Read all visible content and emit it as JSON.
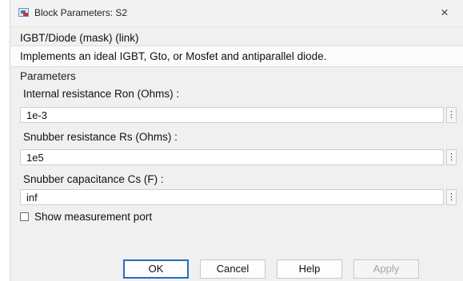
{
  "window": {
    "title": "Block Parameters: S2",
    "close_glyph": "×"
  },
  "mask": {
    "title": "IGBT/Diode (mask) (link)",
    "description": "Implements an ideal  IGBT, Gto, or Mosfet and antiparallel diode."
  },
  "parameters": {
    "group_label": "Parameters",
    "fields": [
      {
        "label": "Internal resistance Ron (Ohms) :",
        "value": "1e-3"
      },
      {
        "label": "Snubber resistance Rs (Ohms) :",
        "value": "1e5"
      },
      {
        "label": "Snubber capacitance Cs (F) :",
        "value": "inf"
      }
    ],
    "more_glyph": "⋮",
    "checkbox": {
      "label": "Show measurement port",
      "checked": false
    }
  },
  "buttons": {
    "ok": "OK",
    "cancel": "Cancel",
    "help": "Help",
    "apply": "Apply"
  },
  "colors": {
    "dialog_bg": "#f0f0f0",
    "default_button_border": "#1f6fbf"
  }
}
